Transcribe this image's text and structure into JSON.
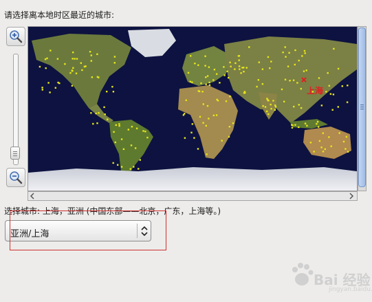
{
  "prompt": "请选择离本地时区最近的城市:",
  "map": {
    "selected_city_label": "上海",
    "marker_symbol": "x",
    "city_dot_color": "#e6e619",
    "ocean_color": "#0d1240",
    "land_color": "#6b7a3c",
    "marker_color": "#e02020"
  },
  "zoom": {
    "zoom_in_icon": "zoom-in-icon",
    "zoom_out_icon": "zoom-out-icon"
  },
  "selection": {
    "text": "选择城市: 上海，亚洲 (中国东部——北京，广东，上海等。)"
  },
  "timezone_select": {
    "value": "亚洲/上海",
    "icon": "select-arrows-icon"
  },
  "watermark": {
    "text": "Bai 经验",
    "url": "jingyan.baidu.com"
  },
  "annotation": {
    "highlight_color": "#d03030"
  }
}
